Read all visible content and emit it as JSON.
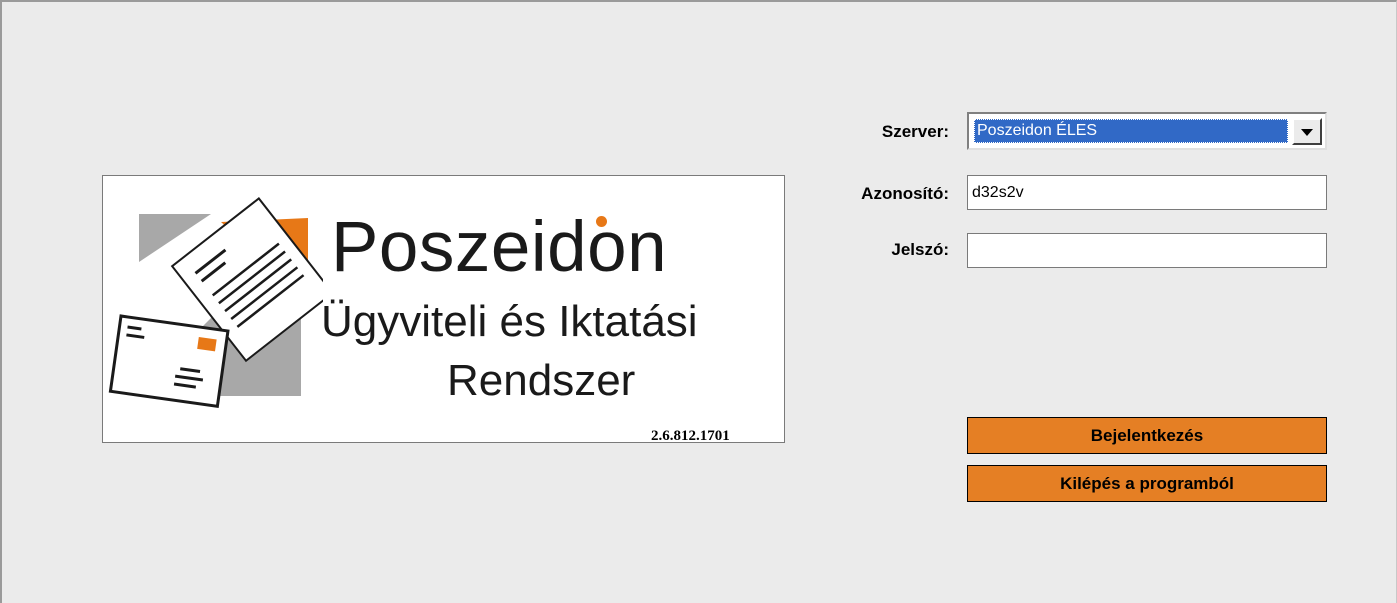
{
  "logo": {
    "title": "Poszeidon",
    "subtitle_line1": "Ügyviteli és Iktatási",
    "subtitle_line2": "Rendszer",
    "version": "2.6.812.1701"
  },
  "form": {
    "server_label": "Szerver:",
    "server_value": "Poszeidon ÉLES",
    "id_label": "Azonosító:",
    "id_value": "d32s2v",
    "password_label": "Jelszó:",
    "password_value": ""
  },
  "buttons": {
    "login": "Bejelentkezés",
    "exit": "Kilépés a programból"
  },
  "colors": {
    "accent_orange": "#e57f24",
    "logo_orange": "#e77817",
    "logo_gray": "#a8a8a8",
    "selection_blue": "#3169c6",
    "background": "#ebebeb"
  },
  "icons": {
    "logo_graphic": "envelope-letter-icon",
    "dropdown": "chevron-down-icon"
  }
}
